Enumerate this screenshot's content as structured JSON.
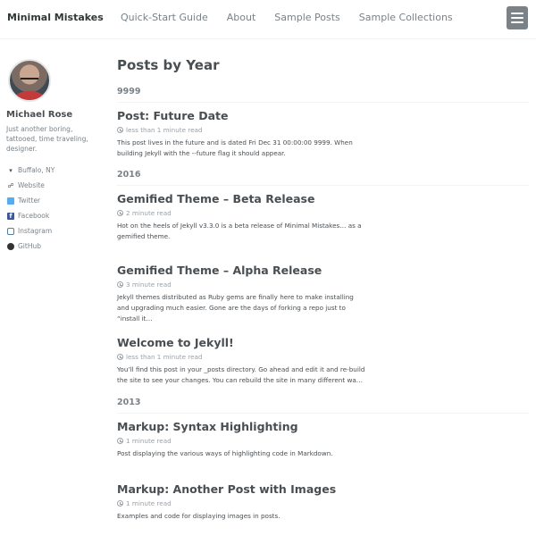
{
  "masthead": {
    "site_title": "Minimal Mistakes",
    "nav": [
      "Quick-Start Guide",
      "About",
      "Sample Posts",
      "Sample Collections"
    ],
    "menu_icon": "hamburger-menu-icon"
  },
  "author": {
    "name": "Michael Rose",
    "bio": "Just another boring, tattooed, time traveling, designer.",
    "links": [
      {
        "icon": "map-marker-icon",
        "label": "Buffalo, NY"
      },
      {
        "icon": "link-icon",
        "label": "Website"
      },
      {
        "icon": "twitter-icon",
        "label": "Twitter"
      },
      {
        "icon": "facebook-icon",
        "label": "Facebook"
      },
      {
        "icon": "instagram-icon",
        "label": "Instagram"
      },
      {
        "icon": "github-icon",
        "label": "GitHub"
      }
    ]
  },
  "main": {
    "title": "Posts by Year",
    "years": [
      "9999",
      "2016",
      "2013"
    ],
    "posts": [
      {
        "title": "Post: Future Date",
        "read_time": "less than 1 minute read",
        "excerpt": "This post lives in the future and is dated Fri Dec 31 00:00:00 9999. When building Jekyll with the --future flag it should appear."
      },
      {
        "title": "Gemified Theme – Beta Release",
        "read_time": "2 minute read",
        "excerpt": "Hot on the heels of Jekyll v3.3.0 is a beta release of Minimal Mistakes… as a gemified theme."
      },
      {
        "title": "Gemified Theme – Alpha Release",
        "read_time": "3 minute read",
        "excerpt": "Jekyll themes distributed as Ruby gems are finally here to make installing and upgrading much easier. Gone are the days of forking a repo just to “install it…"
      },
      {
        "title": "Welcome to Jekyll!",
        "read_time": "less than 1 minute read",
        "excerpt": "You’ll find this post in your _posts directory. Go ahead and edit it and re-build the site to see your changes. You can rebuild the site in many different wa…"
      },
      {
        "title": "Markup: Syntax Highlighting",
        "read_time": "1 minute read",
        "excerpt": "Post displaying the various ways of highlighting code in Markdown."
      },
      {
        "title": "Markup: Another Post with Images",
        "read_time": "1 minute read",
        "excerpt": "Examples and code for displaying images in posts."
      }
    ]
  },
  "colors": {
    "text": "#494e52",
    "muted": "#7a8288",
    "menu_button": "#7a8288"
  }
}
